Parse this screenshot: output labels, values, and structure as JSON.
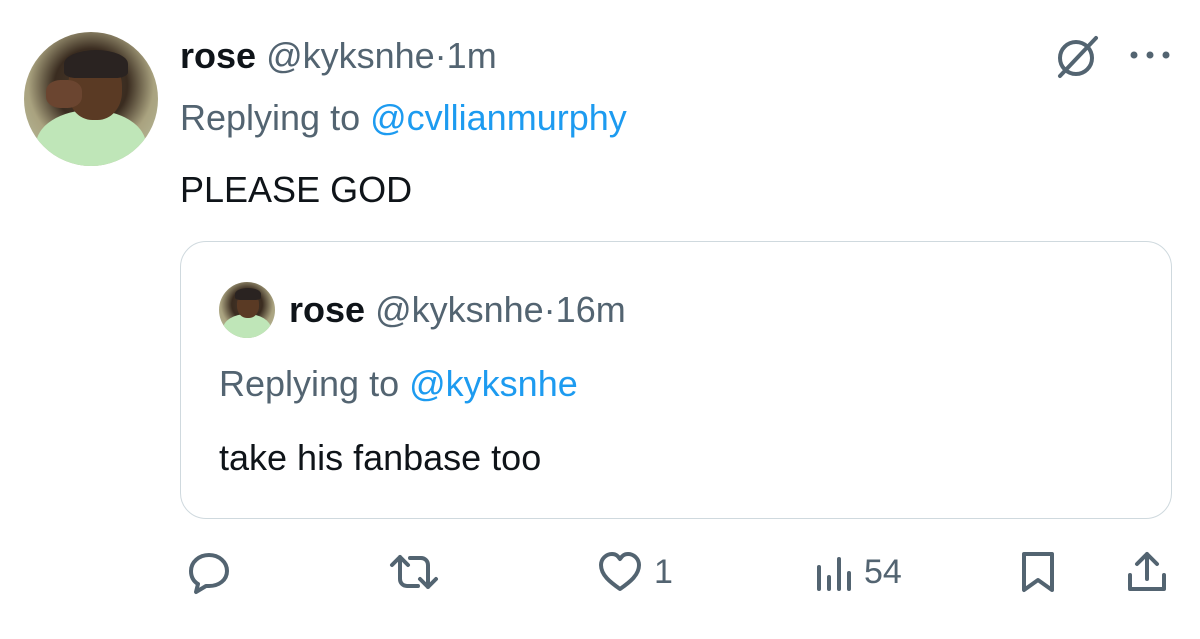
{
  "tweet": {
    "author_name": "rose",
    "author_handle": "@kyksnhe",
    "separator": "·",
    "time": "1m",
    "replying_prefix": "Replying to",
    "replying_to": "@cvllianmurphy",
    "text": "PLEASE GOD"
  },
  "quote": {
    "author_name": "rose",
    "author_handle": "@kyksnhe",
    "separator": "·",
    "time": "16m",
    "replying_prefix": "Replying to",
    "replying_to": "@kyksnhe",
    "text": "take his fanbase too"
  },
  "actions": {
    "likes": "1",
    "views": "54"
  },
  "colors": {
    "text": "#0f1419",
    "secondary": "#536471",
    "link": "#1d9bf0",
    "border": "#cfd9de"
  },
  "icons": [
    "grok-icon",
    "more-icon",
    "reply-icon",
    "retweet-icon",
    "like-icon",
    "views-icon",
    "bookmark-icon",
    "share-icon"
  ]
}
